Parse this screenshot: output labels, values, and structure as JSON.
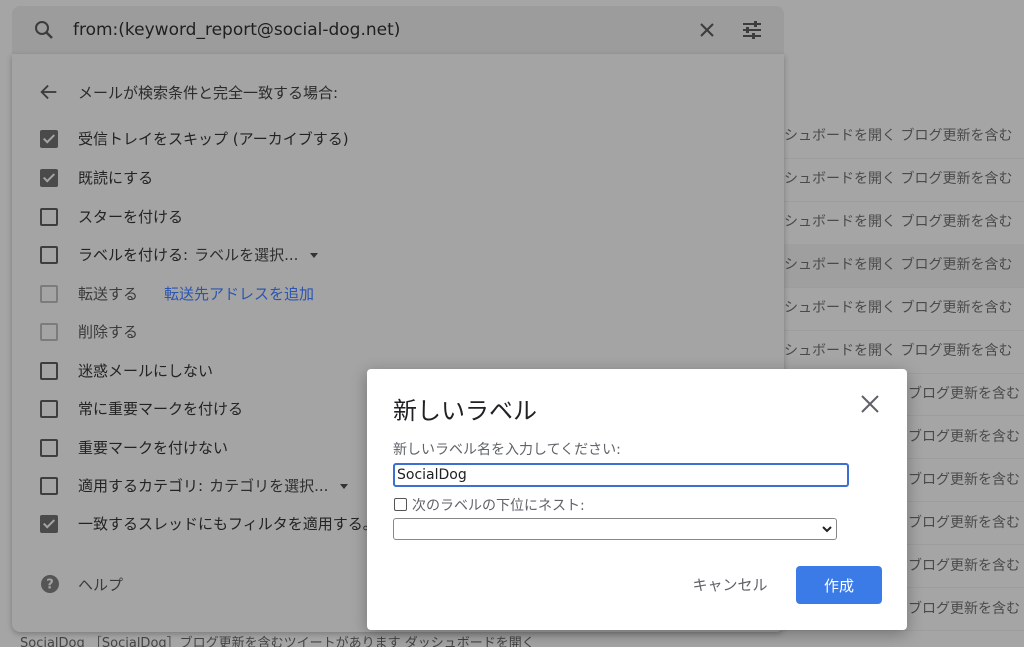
{
  "search": {
    "query": "from:(keyword_report@social-dog.net)"
  },
  "filter_panel": {
    "title": "メールが検索条件と完全一致する場合:",
    "options": [
      {
        "label": "受信トレイをスキップ (アーカイブする)",
        "checked": true
      },
      {
        "label": "既読にする",
        "checked": true
      },
      {
        "label": "スターを付ける",
        "checked": false
      },
      {
        "label": "ラベルを付ける:",
        "checked": false,
        "select": "ラベルを選択..."
      },
      {
        "label": "転送する",
        "checked": false,
        "link": "転送先アドレスを追加"
      },
      {
        "label": "削除する",
        "checked": false
      },
      {
        "label": "迷惑メールにしない",
        "checked": false
      },
      {
        "label": "常に重要マークを付ける",
        "checked": false
      },
      {
        "label": "重要マークを付けない",
        "checked": false
      },
      {
        "label": "適用するカテゴリ:",
        "checked": false,
        "select": "カテゴリを選択..."
      },
      {
        "label": "一致するスレッドにもフィルタを適用する。",
        "checked": true
      }
    ],
    "help": "ヘルプ"
  },
  "background": {
    "rows": [
      "シュボードを開く ブログ更新を含む",
      "シュボードを開く ブログ更新を含む",
      "シュボードを開く ブログ更新を含む",
      "シュボードを開く ブログ更新を含む",
      "シュボードを開く ブログ更新を含む",
      "シュボードを開く ブログ更新を含む",
      "ブログ更新を含む",
      "ブログ更新を含む",
      "ブログ更新を含む",
      "ブログ更新を含む",
      "ブログ更新を含む",
      "ブログ更新を含む"
    ],
    "bottom_row": "SocialDog ［SocialDog］ブログ更新を含むツイートがあります ダッシュボードを開く"
  },
  "dialog": {
    "title": "新しいラベル",
    "prompt": "新しいラベル名を入力してください:",
    "input_value": "SocialDog",
    "nest_label": "次のラベルの下位にネスト:",
    "nest_select": "",
    "cancel": "キャンセル",
    "create": "作成"
  },
  "colors": {
    "primary": "#3a7be8",
    "link": "#2a55b0"
  }
}
